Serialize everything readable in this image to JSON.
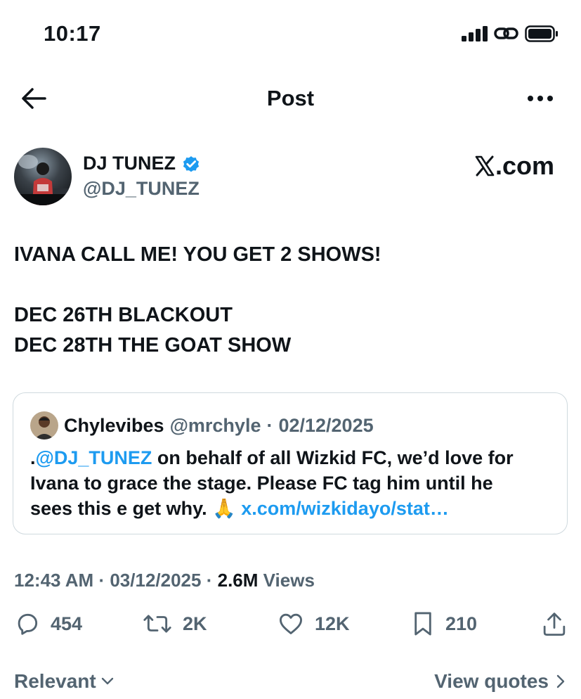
{
  "status_bar": {
    "time": "10:17"
  },
  "nav": {
    "title": "Post"
  },
  "author": {
    "name": "DJ TUNEZ",
    "handle": "@DJ_TUNEZ",
    "verified": true,
    "source_logo_text": ".com"
  },
  "post": {
    "lines": [
      "IVANA CALL ME! YOU GET 2 SHOWS!",
      "DEC 26TH BLACKOUT",
      "DEC 28TH THE GOAT SHOW"
    ]
  },
  "quote": {
    "name": "Chylevibes",
    "handle": "@mrchyle",
    "separator": "·",
    "date": "02/12/2025",
    "line1_prefix": ".",
    "line1_mention": "@DJ_TUNEZ",
    "line1_rest": " on behalf of all Wizkid FC, we’d love for",
    "line2": "Ivana to grace the stage. Please FC tag him until he",
    "line3_text": "sees this e get why. ",
    "line3_emoji": "🙏",
    "line3_link": "x.com/wizkidayo/stat…"
  },
  "meta": {
    "time": "12:43 AM",
    "separator": "·",
    "date": "03/12/2025",
    "views_count": "2.6M",
    "views_label": "Views"
  },
  "actions": {
    "replies": "454",
    "reposts": "2K",
    "likes": "12K",
    "bookmarks": "210"
  },
  "footer": {
    "sort_label": "Relevant",
    "view_quotes_label": "View quotes"
  },
  "colors": {
    "text": "#0f1419",
    "muted": "#536471",
    "link": "#1d9bf0",
    "verified": "#1d9bf0",
    "border": "#cfd9de"
  }
}
